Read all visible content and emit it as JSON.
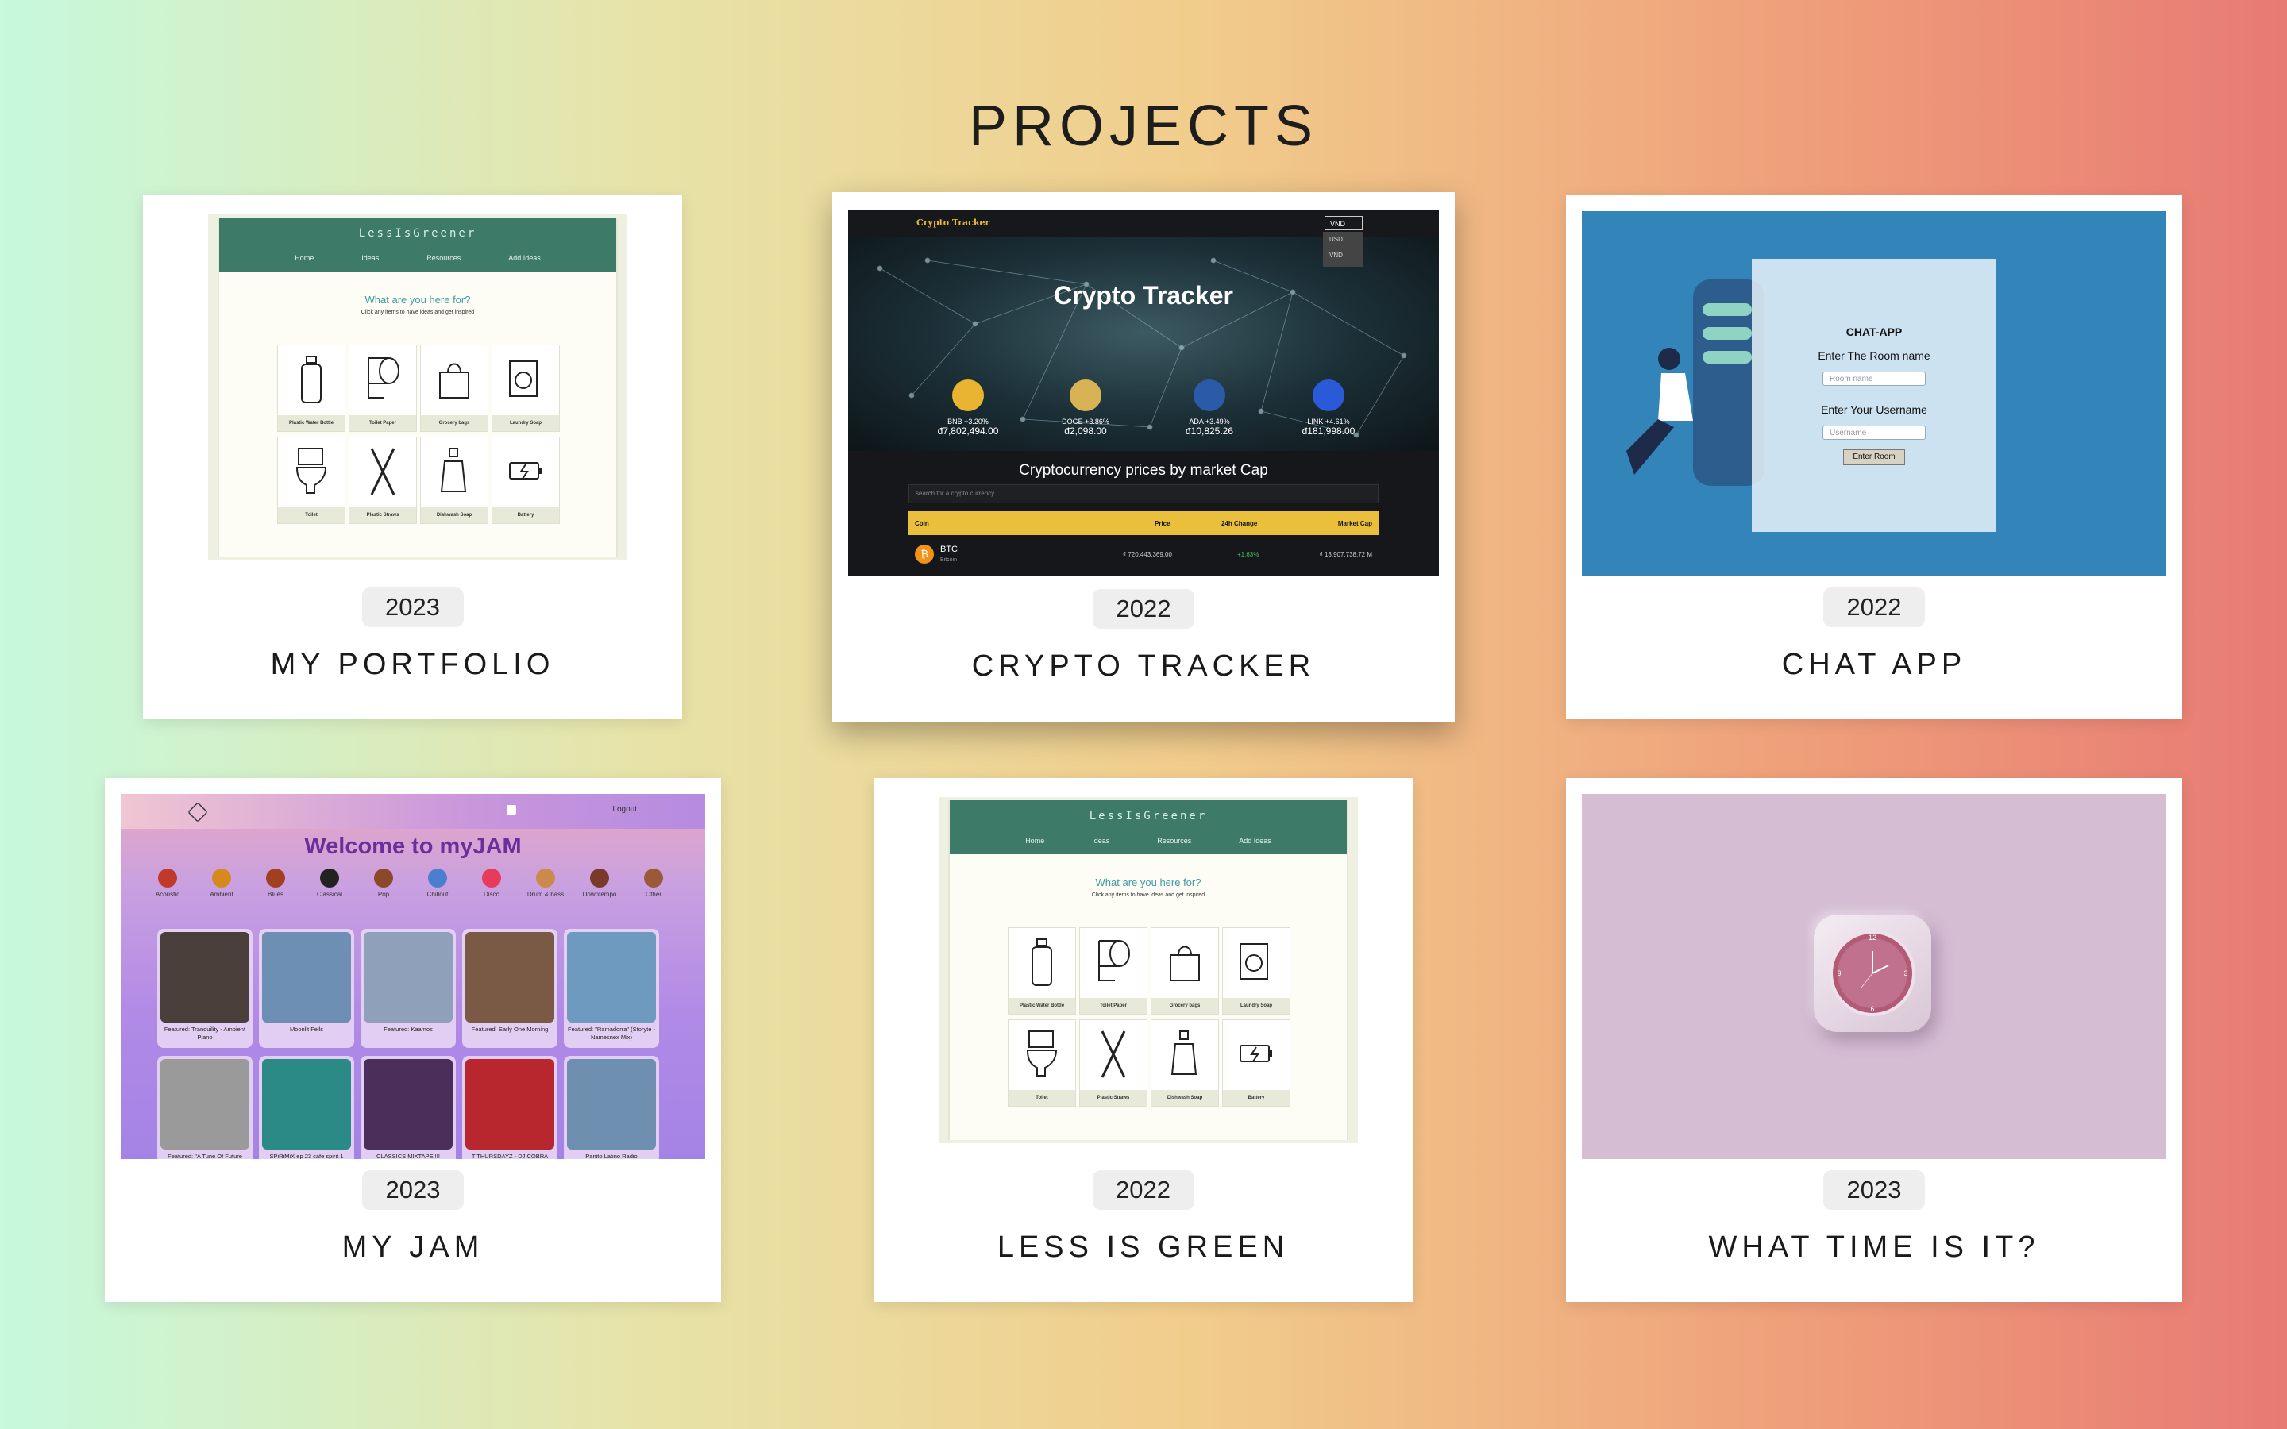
{
  "page_title": "PROJECTS",
  "projects": [
    {
      "name": "MY PORTFOLIO",
      "year": "2023"
    },
    {
      "name": "CRYPTO TRACKER",
      "year": "2022"
    },
    {
      "name": "CHAT APP",
      "year": "2022"
    },
    {
      "name": "MY JAM",
      "year": "2023"
    },
    {
      "name": "LESS IS GREEN",
      "year": "2022"
    },
    {
      "name": "WHAT TIME IS IT?",
      "year": "2023"
    }
  ],
  "lessisgreen": {
    "brand": "LessIsGreener",
    "nav": [
      "Home",
      "Ideas",
      "Resources",
      "Add Ideas"
    ],
    "question": "What are you here for?",
    "subtitle": "Click any items to have ideas and get inspired",
    "items": [
      "Plastic Water Bottle",
      "Toilet Paper",
      "Grocery bags",
      "Laundry Soap",
      "Toilet",
      "Plastic Straws",
      "Dishwash Soap",
      "Battery"
    ]
  },
  "crypto": {
    "logo": "Crypto Tracker",
    "currency": "VND",
    "currency_options": [
      "USD",
      "VND"
    ],
    "hero_title": "Crypto Tracker",
    "coins": [
      {
        "label": "BNB +3.20%",
        "price": "đ7,802,494.00",
        "color": "#e8b431"
      },
      {
        "label": "DOGE +3.86%",
        "price": "đ2,098.00",
        "color": "#d8b255"
      },
      {
        "label": "ADA +3.49%",
        "price": "đ10,825.26",
        "color": "#2a5aa8"
      },
      {
        "label": "LINK +4.61%",
        "price": "đ181,998.00",
        "color": "#2a5ad8"
      }
    ],
    "section_title": "Cryptocurrency prices by market Cap",
    "search_placeholder": "search for a crypto currency..",
    "columns": [
      "Coin",
      "Price",
      "24h Change",
      "Market Cap"
    ],
    "row": {
      "symbol": "BTC",
      "name": "Bitcoin",
      "price": "₫ 720,443,369.00",
      "change": "+1.63%",
      "cap": "₫ 13,907,738,72 M"
    }
  },
  "chat": {
    "title": "CHAT-APP",
    "room_label": "Enter The Room name",
    "room_placeholder": "Room name",
    "user_label": "Enter Your Username",
    "user_placeholder": "Username",
    "button": "Enter Room"
  },
  "jam": {
    "logout": "Logout",
    "welcome": "Welcome to myJAM",
    "genres": [
      "Acoustic",
      "Ambient",
      "Blues",
      "Classical",
      "Pop",
      "Chillout",
      "Disco",
      "Drum & bass",
      "Downtempo",
      "Other"
    ],
    "tiles": [
      {
        "caption": "Featured: Tranquility - Ambient Piano",
        "color": "#4a3f3a"
      },
      {
        "caption": "Moonlit Fells",
        "color": "#6e8fb4"
      },
      {
        "caption": "Featured: Kaamos",
        "color": "#8ea0ba"
      },
      {
        "caption": "Featured: Early One Morning",
        "color": "#7a5a44"
      },
      {
        "caption": "Featured: \"Ramadorra\" (Storyte - Namesnex Mix)",
        "color": "#6f9ac0"
      },
      {
        "caption": "Featured: \"A Tune Of Future",
        "color": "#9a9a9a"
      },
      {
        "caption": "SPiRiMiX ep 23 cafe spirit 1",
        "color": "#2c8a86"
      },
      {
        "caption": "CLASSICS MIXTAPE !!!",
        "color": "#4b2f5a"
      },
      {
        "caption": "T THURSDAYZ - DJ COBRA",
        "color": "#b8262e"
      },
      {
        "caption": "Panito Latino Radio",
        "color": "#6f8fb0"
      }
    ]
  },
  "clock": {
    "numerals": [
      "12",
      "3",
      "6",
      "9"
    ]
  }
}
